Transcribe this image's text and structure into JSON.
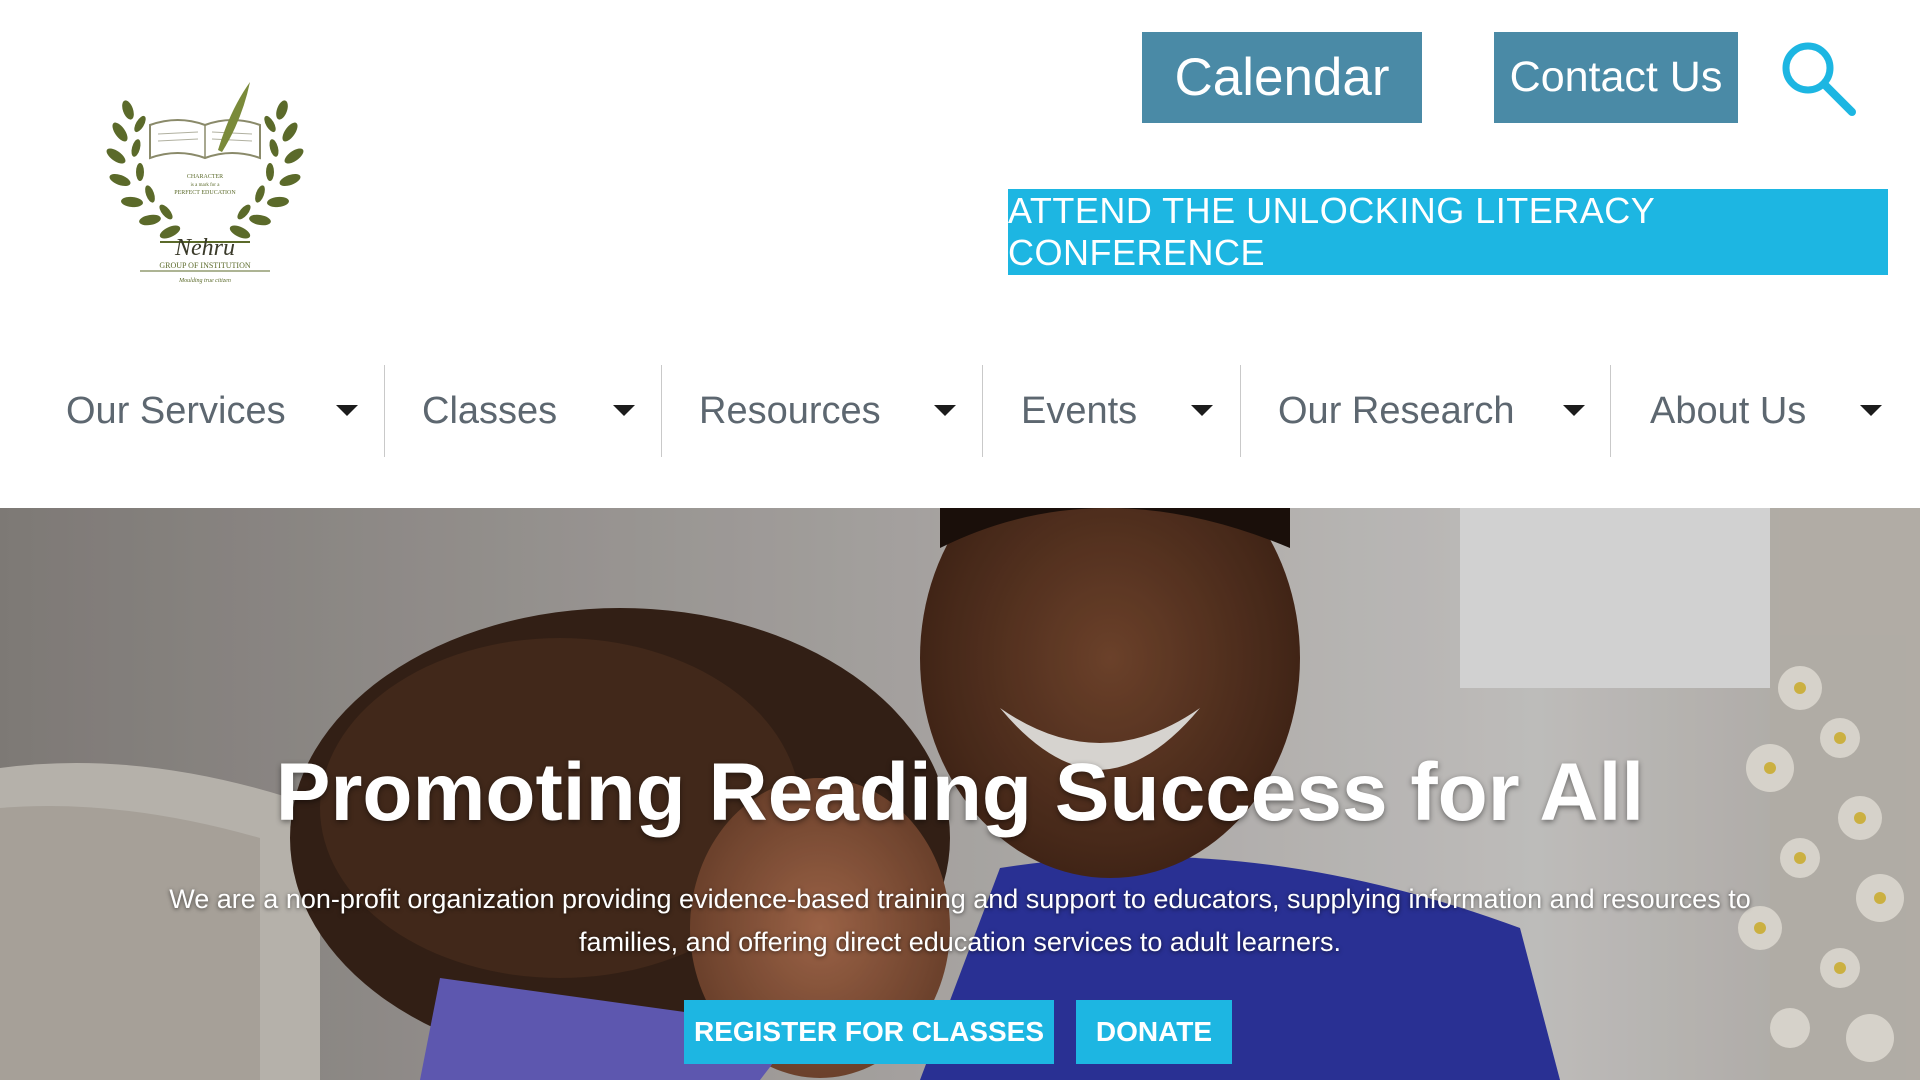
{
  "logo": {
    "text_tagline": "CHARACTER is a mark for a PERFECT EDUCATION",
    "text_name": "Nehru",
    "text_group": "GROUP OF INSTITUTION",
    "text_motto": "Moulding true citizen"
  },
  "header": {
    "calendar_label": "Calendar",
    "contact_label": "Contact Us",
    "search_icon": "search-icon",
    "conference_label": "ATTEND THE UNLOCKING LITERACY CONFERENCE"
  },
  "nav": {
    "items": [
      {
        "label": "Our Services"
      },
      {
        "label": "Classes"
      },
      {
        "label": "Resources"
      },
      {
        "label": "Events"
      },
      {
        "label": "Our Research"
      },
      {
        "label": "About Us"
      }
    ]
  },
  "hero": {
    "title": "Promoting Reading Success for All",
    "subtitle_line1": "We are a non-profit organization providing evidence-based training and support to educators, supplying information and resources to",
    "subtitle_line2": "families, and offering direct education services to adult learners.",
    "register_label": "REGISTER FOR CLASSES",
    "donate_label": "DONATE"
  },
  "colors": {
    "top_button": "#4a8aa6",
    "accent": "#1db6e2",
    "nav_text": "#5d6770",
    "olive": "#5b6a2a"
  }
}
